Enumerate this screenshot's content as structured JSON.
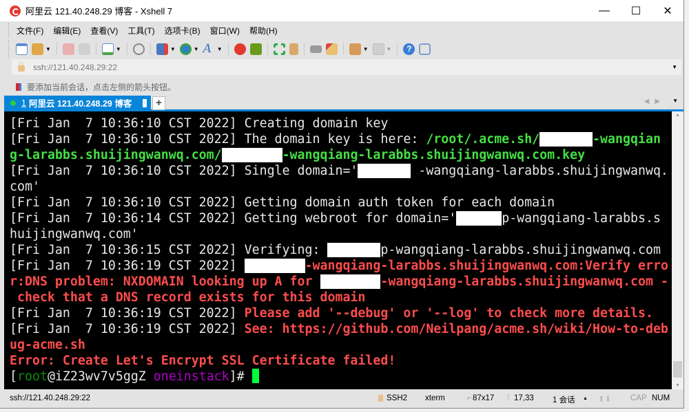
{
  "window": {
    "title": "阿里云 121.40.248.29 博客 - Xshell 7",
    "minimize": "—",
    "maximize": "☐",
    "close": "✕"
  },
  "menu": [
    "文件(F)",
    "编辑(E)",
    "查看(V)",
    "工具(T)",
    "选项卡(B)",
    "窗口(W)",
    "帮助(H)"
  ],
  "address": {
    "value": "ssh://121.40.248.29:22"
  },
  "hint": "要添加当前会话，点击左侧的箭头按钮。",
  "tab": {
    "number": "1",
    "label": "阿里云 121.40.248.29 博客",
    "close": "×",
    "new": "+"
  },
  "terminal": {
    "lines": [
      [
        {
          "c": "w",
          "t": "[Fri Jan  7 10:36:10 CST 2022] Creating domain key"
        }
      ],
      [
        {
          "c": "w",
          "t": "[Fri Jan  7 10:36:10 CST 2022] The domain key is here: "
        },
        {
          "c": "g",
          "t": "/root/.acme.sh/"
        },
        {
          "c": "x",
          "t": "       "
        },
        {
          "c": "g",
          "t": "-wangqian"
        }
      ],
      [
        {
          "c": "g",
          "t": "g-larabbs.shuijingwanwq.com/"
        },
        {
          "c": "x",
          "t": "        "
        },
        {
          "c": "g",
          "t": "-wangqiang-larabbs.shuijingwanwq.com.key"
        }
      ],
      [
        {
          "c": "w",
          "t": "[Fri Jan  7 10:36:10 CST 2022] Single domain='"
        },
        {
          "c": "x",
          "t": "       "
        },
        {
          "c": "w",
          "t": " -wangqiang-larabbs.shuijingwanwq."
        }
      ],
      [
        {
          "c": "w",
          "t": "com'"
        }
      ],
      [
        {
          "c": "w",
          "t": "[Fri Jan  7 10:36:10 CST 2022] Getting domain auth token for each domain"
        }
      ],
      [
        {
          "c": "w",
          "t": "[Fri Jan  7 10:36:14 CST 2022] Getting webroot for domain='"
        },
        {
          "c": "x",
          "t": "      "
        },
        {
          "c": "w",
          "t": "p-wangqiang-larabbs.s"
        }
      ],
      [
        {
          "c": "w",
          "t": "huijingwanwq.com'"
        }
      ],
      [
        {
          "c": "w",
          "t": "[Fri Jan  7 10:36:15 CST 2022] Verifying: "
        },
        {
          "c": "x",
          "t": "       "
        },
        {
          "c": "w",
          "t": "p-wangqiang-larabbs.shuijingwanwq.com"
        }
      ],
      [
        {
          "c": "w",
          "t": "[Fri Jan  7 10:36:19 CST 2022] "
        },
        {
          "c": "x",
          "t": "        "
        },
        {
          "c": "r",
          "t": "-wangqiang-larabbs.shuijingwanwq.com:Verify erro"
        }
      ],
      [
        {
          "c": "r",
          "t": "r:DNS problem: NXDOMAIN looking up A for "
        },
        {
          "c": "x",
          "t": "        "
        },
        {
          "c": "r",
          "t": "-wangqiang-larabbs.shuijingwanwq.com -"
        }
      ],
      [
        {
          "c": "r",
          "t": " check that a DNS record exists for this domain"
        }
      ],
      [
        {
          "c": "w",
          "t": "[Fri Jan  7 10:36:19 CST 2022] "
        },
        {
          "c": "r",
          "t": "Please add '--debug' or '--log' to check more details."
        }
      ],
      [
        {
          "c": "w",
          "t": "[Fri Jan  7 10:36:19 CST 2022] "
        },
        {
          "c": "r",
          "t": "See: https://github.com/Neilpang/acme.sh/wiki/How-to-deb"
        }
      ],
      [
        {
          "c": "r",
          "t": "ug-acme.sh"
        }
      ],
      [
        {
          "c": "r",
          "t": "Error: Create Let's Encrypt SSL Certificate failed!"
        }
      ],
      [
        {
          "c": "w",
          "t": "["
        },
        {
          "c": "dg",
          "t": "root"
        },
        {
          "c": "w",
          "t": "@iZ23wv7v5ggZ "
        },
        {
          "c": "pu",
          "t": "oneinstack"
        },
        {
          "c": "w",
          "t": "]# "
        }
      ]
    ]
  },
  "status": {
    "address": "ssh://121.40.248.29:22",
    "protocol": "SSH2",
    "term": "xterm",
    "size": "87x17",
    "cursor": "17,33",
    "sessions": "1 会话",
    "cap": "CAP",
    "num": "NUM"
  },
  "colors": {
    "accent": "#0a84d8",
    "green": "#44e044",
    "red": "#ff4d4d"
  }
}
